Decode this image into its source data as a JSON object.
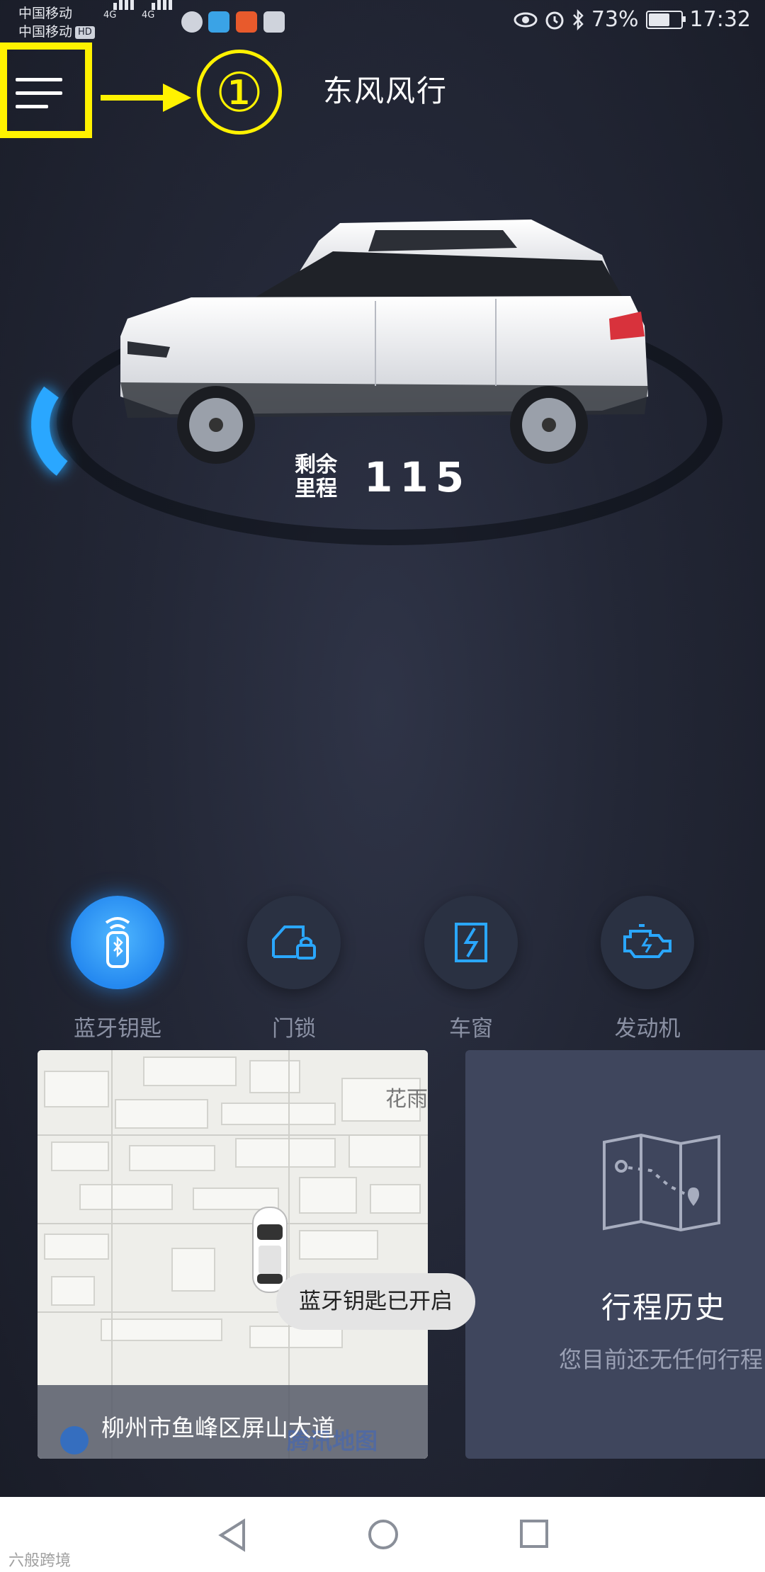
{
  "status_bar": {
    "carrier_1": "中国移动",
    "carrier_2": "中国移动",
    "hd_badge": "HD",
    "network_1": "4G",
    "network_2": "4G",
    "battery_percent": "73%",
    "battery_level": 0.73,
    "time": "17:32",
    "icons": [
      "eye-icon",
      "alarm-icon",
      "bluetooth-icon",
      "battery-icon"
    ]
  },
  "header": {
    "title": "东风风行",
    "menu_icon": "hamburger-icon",
    "annotation_number": "①"
  },
  "vehicle": {
    "mileage_label": "剩余里程",
    "mileage_value": "115"
  },
  "controls": [
    {
      "label": "蓝牙钥匙",
      "icon": "bluetooth-key-icon",
      "active": true
    },
    {
      "label": "门锁",
      "icon": "door-lock-icon",
      "active": false
    },
    {
      "label": "车窗",
      "icon": "window-icon",
      "active": false
    },
    {
      "label": "发动机",
      "icon": "engine-icon",
      "active": false
    }
  ],
  "map_card": {
    "poi_label": "花雨",
    "address": "柳州市鱼峰区屏山大道",
    "watermark": "腾讯地图"
  },
  "toast": {
    "text": "蓝牙钥匙已开启"
  },
  "trip_card": {
    "title": "行程历史",
    "subtitle": "您目前还无任何行程",
    "icon": "map-route-icon"
  },
  "nav_bar": {
    "back": "back-triangle-icon",
    "home": "home-circle-icon",
    "recents": "recents-square-icon"
  },
  "watermark": {
    "text": "六般跨境"
  },
  "colors": {
    "accent_blue": "#2aa7ff",
    "annotation_yellow": "#fff200",
    "background_dark": "#232736",
    "trip_card_bg": "#3f465d"
  }
}
